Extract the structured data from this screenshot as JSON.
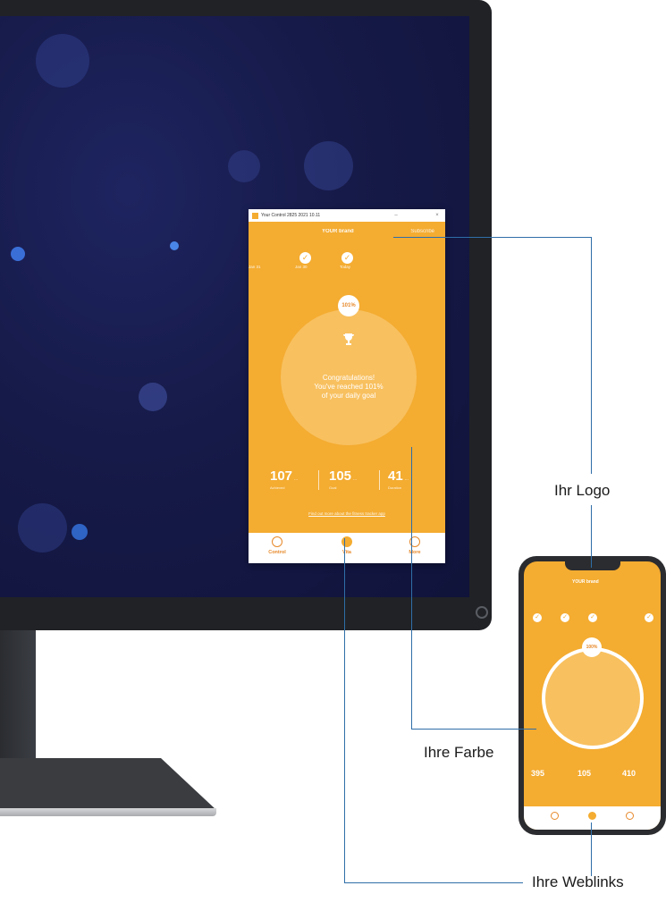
{
  "desktop_app": {
    "window_title": "Your Control 2825 2021 10.11",
    "minimize_symbol": "–",
    "close_symbol": "×",
    "brand": "YOUR brand",
    "header_right": "Subscribe",
    "goal_items": [
      {
        "label": "Jan 31"
      },
      {
        "label": "Jan 30"
      },
      {
        "label": "Today"
      }
    ],
    "progress_badge": "101%",
    "congrats_line1": "Congratulations!",
    "congrats_line2": "You've reached 101%",
    "congrats_line3": "of your daily goal",
    "stats": [
      {
        "value": "107",
        "unit": "...",
        "caption": "Achieved"
      },
      {
        "value": "105",
        "unit": "...",
        "caption": "Goal"
      },
      {
        "value": "41",
        "unit": "...",
        "caption": "Duration"
      }
    ],
    "footer_link": "Find out more about the fitness tracker app",
    "tabs": [
      {
        "label": "Control"
      },
      {
        "label": "Vita"
      },
      {
        "label": "More"
      }
    ]
  },
  "phone_app": {
    "brand": "YOUR brand",
    "progress_badge": "100%",
    "stats": [
      "395",
      "105",
      "410"
    ]
  },
  "callouts": {
    "logo": "Ihr Logo",
    "color": "Ihre Farbe",
    "weblinks": "Ihre Weblinks"
  },
  "colors": {
    "accent": "#f4ac31",
    "callout_line": "#2f6ea8"
  }
}
